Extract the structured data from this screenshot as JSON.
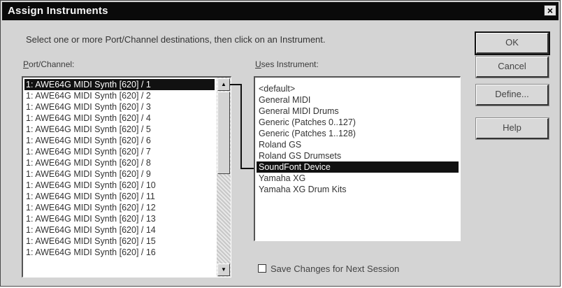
{
  "window": {
    "title": "Assign Instruments",
    "close_label": "×"
  },
  "instructions": "Select one or more Port/Channel destinations, then click on an Instrument.",
  "port_channel": {
    "label_underlined": "P",
    "label_rest": "ort/Channel:",
    "items": [
      "1: AWE64G MIDI Synth [620] / 1",
      "1: AWE64G MIDI Synth [620] / 2",
      "1: AWE64G MIDI Synth [620] / 3",
      "1: AWE64G MIDI Synth [620] / 4",
      "1: AWE64G MIDI Synth [620] / 5",
      "1: AWE64G MIDI Synth [620] / 6",
      "1: AWE64G MIDI Synth [620] / 7",
      "1: AWE64G MIDI Synth [620] / 8",
      "1: AWE64G MIDI Synth [620] / 9",
      "1: AWE64G MIDI Synth [620] / 10",
      "1: AWE64G MIDI Synth [620] / 11",
      "1: AWE64G MIDI Synth [620] / 12",
      "1: AWE64G MIDI Synth [620] / 13",
      "1: AWE64G MIDI Synth [620] / 14",
      "1: AWE64G MIDI Synth [620] / 15",
      "1: AWE64G MIDI Synth [620] / 16"
    ],
    "selected_index": 0
  },
  "instrument": {
    "label_underlined": "U",
    "label_rest": "ses Instrument:",
    "items": [
      "<default>",
      "General MIDI",
      "General MIDI Drums",
      "Generic (Patches 0..127)",
      "Generic (Patches 1..128)",
      "Roland GS",
      "Roland GS Drumsets",
      "SoundFont Device",
      "Yamaha XG",
      "Yamaha XG Drum Kits"
    ],
    "selected_index": 7
  },
  "buttons": {
    "ok": "OK",
    "cancel": "Cancel",
    "define": "Define...",
    "help": "Help"
  },
  "save_option": {
    "label": "Save Changes for Next Session",
    "checked": false
  },
  "colors": {
    "selection_bg": "#111111",
    "dialog_bg": "#d4d4d4",
    "titlebar_bg": "#0a0a0a"
  },
  "icons": {
    "scroll_up": "▲",
    "scroll_down": "▼"
  }
}
